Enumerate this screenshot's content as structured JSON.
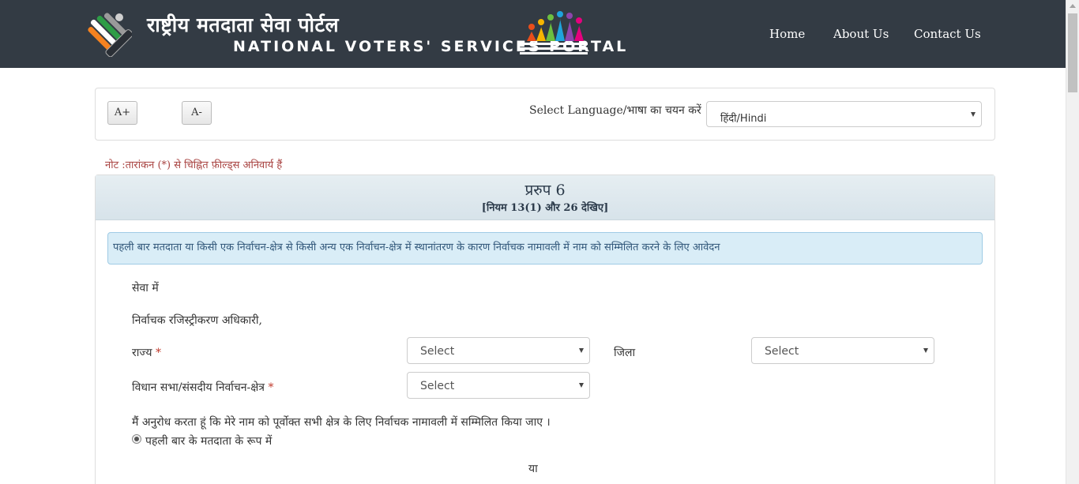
{
  "header": {
    "brand_hindi": "राष्ट्रीय मतदाता सेवा पोर्टल",
    "brand_english": "NATIONAL VOTERS' SERVICES PORTAL",
    "logo_icon": "eci-ballot-finger-logo",
    "badge_icon": "national-voters-day-2015-logo",
    "nav": [
      "Home",
      "About Us",
      "Contact Us"
    ]
  },
  "toolbar": {
    "increase_font": "A+",
    "decrease_font": "A-",
    "language_label": "Select Language/भाषा का चयन करें",
    "language_value": "हिंदी/Hindi"
  },
  "note": "नोट :तारांकन (*) से चिह्नित फ़ील्ड्स अनिवार्य हैं",
  "form": {
    "title": "प्ररुप 6",
    "rule": "[नियम 13(1) और 26 देखिए]",
    "info": "पहली बार मतदाता या किसी एक निर्वाचन-क्षेत्र से किसी अन्य एक निर्वाचन-क्षेत्र में स्थानांतरण के कारण निर्वाचक नामावली में नाम को सम्मिलित करने के लिए आवेदन",
    "to": "सेवा में",
    "officer": "निर्वाचक रजिस्ट्रीकरण अधिकारी,",
    "state_label": "राज्य",
    "district_label": "जिला",
    "constituency_label": "विधान सभा/संसदीय निर्वाचन-क्षेत्र",
    "required_mark": "*",
    "state_value": "Select",
    "district_value": "Select",
    "constituency_value": "Select",
    "request": "मैं अनुरोध करता हूं कि मेरे नाम को पूर्वोक्त सभी क्षेत्र के लिए निर्वाचक नामावली में सम्मिलित किया जाए ।",
    "option_first_time": "पहली बार के मतदाता के रूप में",
    "or": "या"
  },
  "colors": {
    "header_bg": "#333b44",
    "note": "#a94442",
    "info_bg": "#d9edf7",
    "required": "#c0392b"
  }
}
